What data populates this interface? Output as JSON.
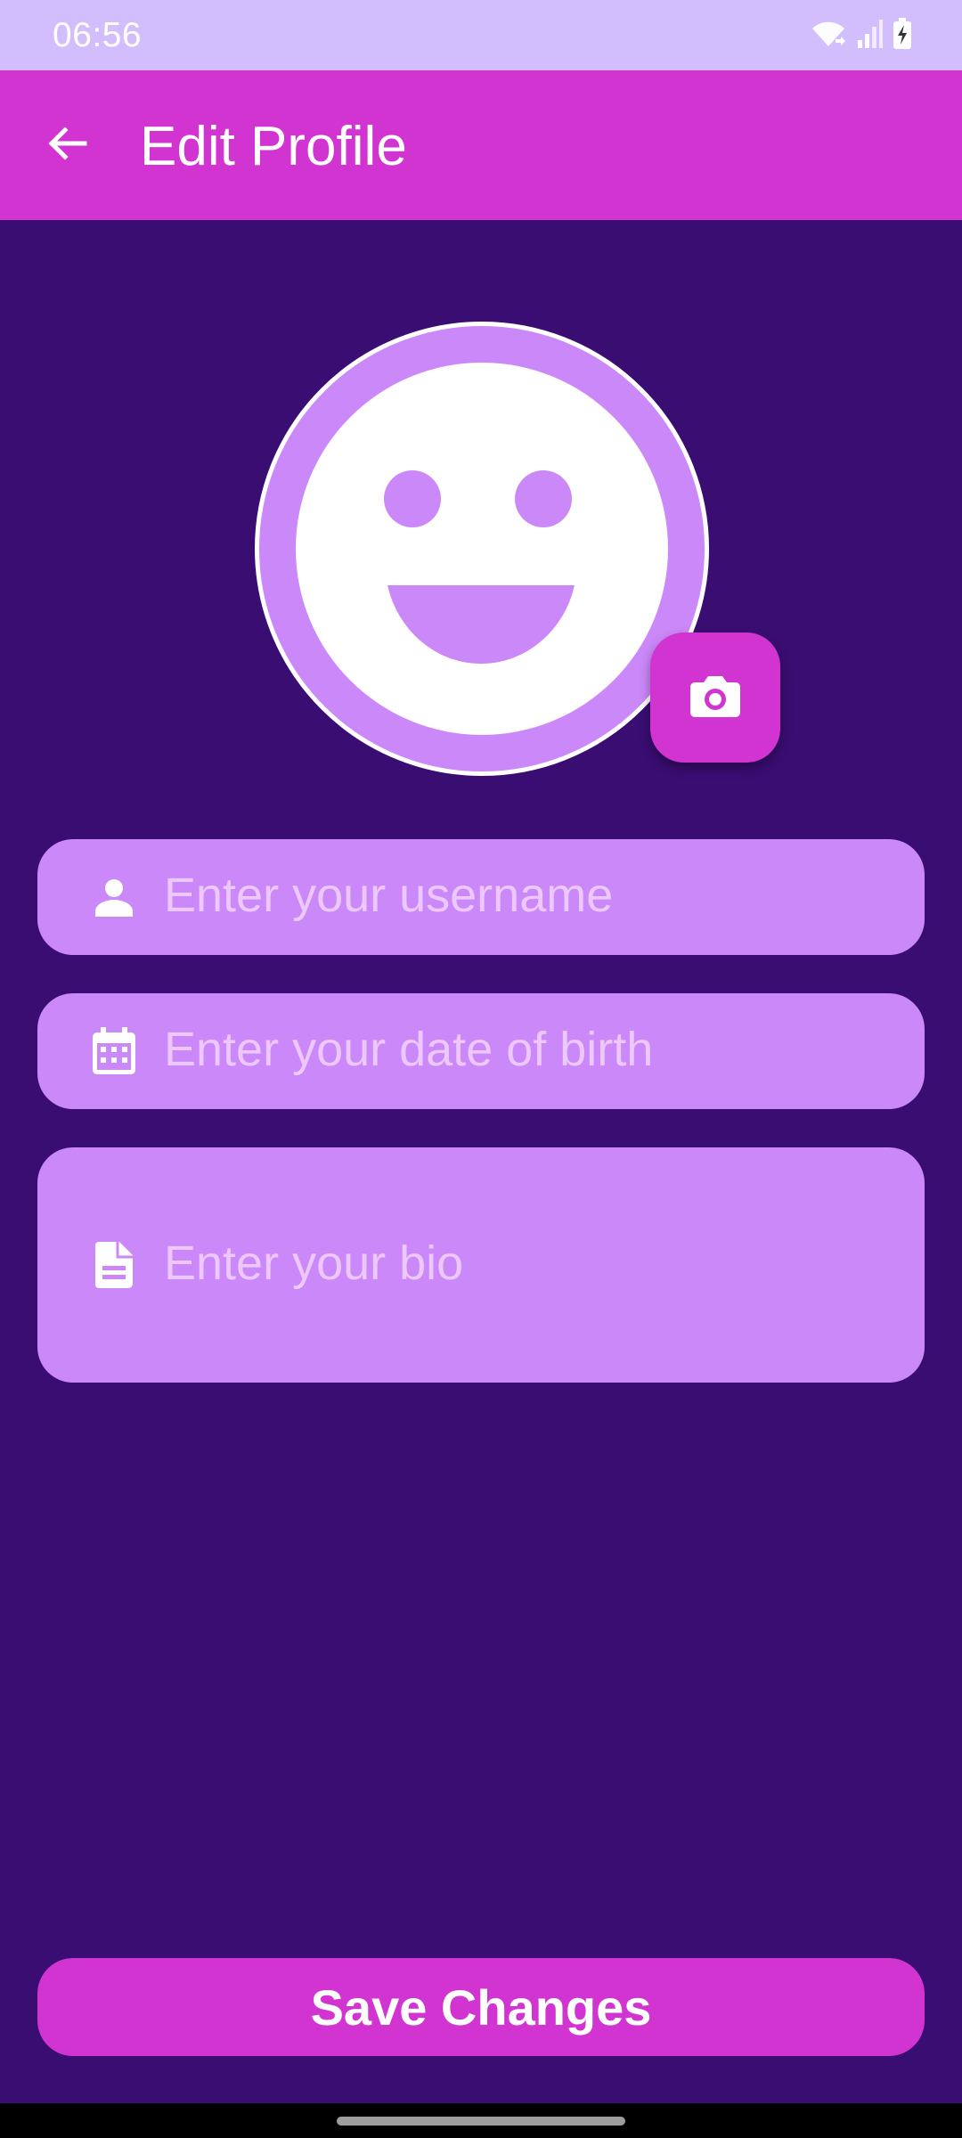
{
  "status_bar": {
    "time": "06:56",
    "icons": [
      "wifi-icon",
      "signal-icon",
      "battery-charging-icon"
    ]
  },
  "app_bar": {
    "back_icon": "arrow-back-icon",
    "title": "Edit Profile"
  },
  "avatar": {
    "icon": "smiley-face-icon",
    "change_photo_icon": "camera-icon"
  },
  "form": {
    "username": {
      "icon": "person-icon",
      "placeholder": "Enter your username",
      "value": ""
    },
    "date_of_birth": {
      "icon": "calendar-icon",
      "placeholder": "Enter your date of birth",
      "value": ""
    },
    "bio": {
      "icon": "document-icon",
      "placeholder": "Enter your bio",
      "value": ""
    }
  },
  "actions": {
    "save_label": "Save Changes"
  },
  "colors": {
    "background": "#3a0d72",
    "status_bar": "#d2bdfd",
    "accent": "#d234d2",
    "field_fill": "#cb88f8",
    "placeholder_text": "#ecc8fc",
    "text_on_accent": "#ffffff"
  }
}
